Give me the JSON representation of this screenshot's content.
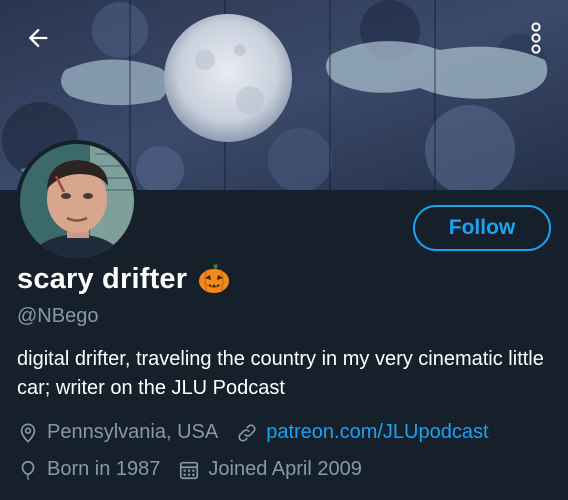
{
  "header": {
    "back_icon": "arrow-left-icon",
    "more_icon": "more-vertical-icon"
  },
  "profile": {
    "display_name": "scary drifter",
    "name_emoji": "jack-o-lantern-icon",
    "handle": "@NBego",
    "bio": "digital drifter, traveling the country in my very cinematic little car; writer on the JLU Podcast",
    "location": "Pennsylvania, USA",
    "website": "patreon.com/JLUpodcast",
    "birth": "Born in 1987",
    "joined": "Joined April 2009"
  },
  "actions": {
    "follow_label": "Follow"
  },
  "colors": {
    "background": "#15202b",
    "accent": "#1da1f2",
    "secondary_text": "#8899a6",
    "primary_text": "#ffffff"
  }
}
